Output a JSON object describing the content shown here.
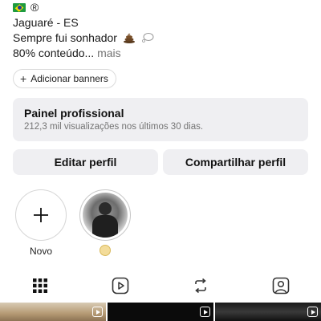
{
  "bio": {
    "registered_mark": "®",
    "location": "Jaguaré - ES",
    "tagline": "Sempre fui sonhador",
    "percent_text": "80% conteúdo...",
    "more_label": "mais"
  },
  "banners": {
    "label": "Adicionar banners"
  },
  "professional_panel": {
    "title": "Painel profissional",
    "subtitle": "212,3 mil visualizações nos últimos 30 dias."
  },
  "actions": {
    "edit_label": "Editar perfil",
    "share_label": "Compartilhar perfil"
  },
  "highlights": {
    "new_label": "Novo"
  },
  "tabs": [
    {
      "icon": "grid-icon",
      "active": true
    },
    {
      "icon": "reels-icon",
      "active": false
    },
    {
      "icon": "reposts-icon",
      "active": false
    },
    {
      "icon": "tagged-icon",
      "active": false
    }
  ],
  "colors": {
    "panel_bg": "#efeff2",
    "secondary_text": "#737373"
  }
}
